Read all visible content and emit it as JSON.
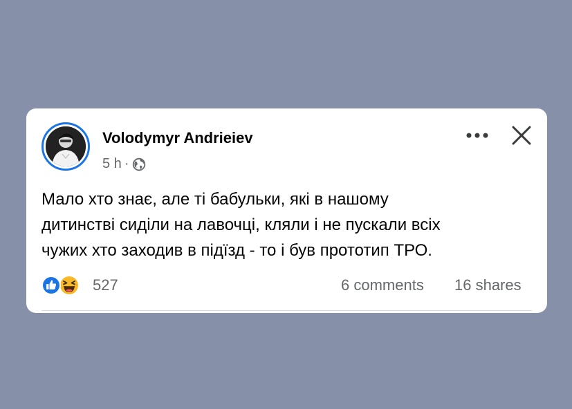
{
  "post": {
    "author": "Volodymyr Andrieiev",
    "time": "5 h",
    "separator": "·",
    "body": "Мало хто знає, але ті бабульки, які в нашому\nдитинстві сиділи на лавочці, кляли і не пускали всіх\nчужих хто заходив в підїзд - то і був прототип ТРО.",
    "reactions": {
      "icons": [
        "like-icon",
        "haha-icon"
      ],
      "count": "527"
    },
    "comments_label": "6 comments",
    "shares_label": "16 shares",
    "audience_icon": "globe-icon",
    "menu_icon": "more-icon",
    "close_icon": "close-icon"
  },
  "colors": {
    "background": "#8690a9",
    "card": "#ffffff",
    "text_primary": "#050505",
    "text_secondary": "#65676b",
    "accent": "#1b74e4",
    "haha": "#f7b928"
  }
}
